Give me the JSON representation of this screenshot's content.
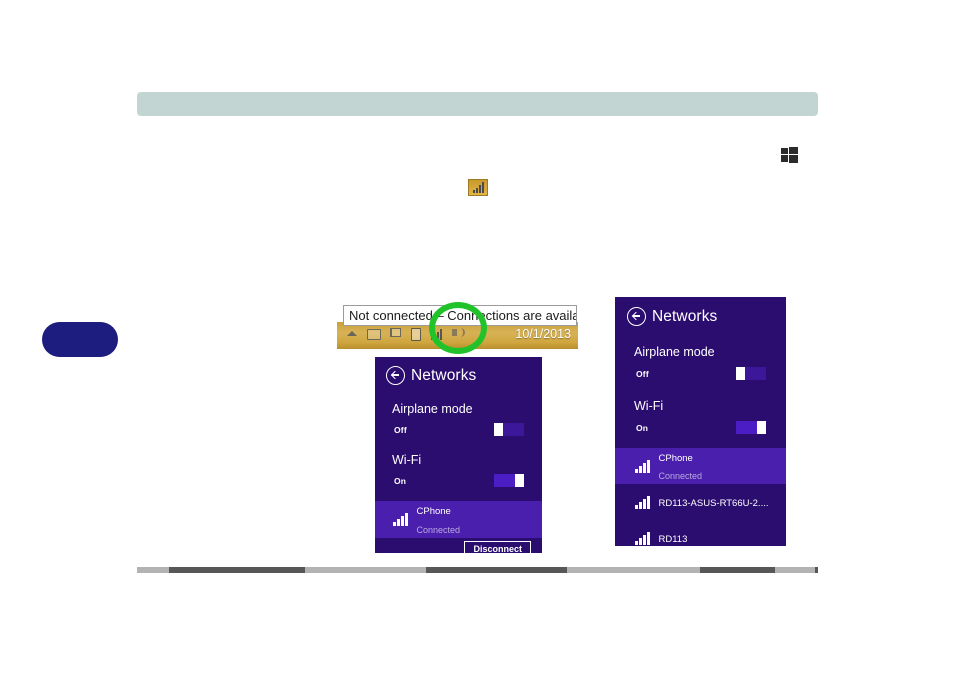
{
  "document": {
    "heading_bar_color": "#c3d5d2",
    "page_badge_color": "#1d1d80",
    "footer_rule_color": "#575757"
  },
  "annotations": {
    "green_circle_color": "#22c32a"
  },
  "windows_key": {
    "icon": "windows-logo-icon"
  },
  "inline_figure": {
    "icon": "wireless-signal-bars-icon"
  },
  "taskbar": {
    "tooltip": "Not connected – Connections are available",
    "clock": "10/1/2013",
    "tray_icons": [
      "show-hidden-icons-chevron-icon",
      "monitor-icon",
      "action-center-flag-icon",
      "battery-icon",
      "wireless-signal-bars-icon",
      "volume-speaker-icon"
    ]
  },
  "panel_mid": {
    "title": "Networks",
    "back_icon": "back-arrow-circle-icon",
    "airplane": {
      "label": "Airplane mode",
      "state": "Off"
    },
    "wifi": {
      "label": "Wi-Fi",
      "state": "On"
    },
    "networks": [
      {
        "name": "CPhone",
        "status": "Connected",
        "selected": true
      }
    ],
    "disconnect_label": "Disconnect"
  },
  "panel_right": {
    "title": "Networks",
    "back_icon": "back-arrow-circle-icon",
    "airplane": {
      "label": "Airplane mode",
      "state": "Off"
    },
    "wifi": {
      "label": "Wi-Fi",
      "state": "On"
    },
    "networks": [
      {
        "name": "CPhone",
        "status": "Connected",
        "selected": true
      },
      {
        "name": "RD113-ASUS-RT66U-2....",
        "status": "",
        "selected": false
      },
      {
        "name": "RD113",
        "status": "",
        "selected": false
      }
    ]
  }
}
